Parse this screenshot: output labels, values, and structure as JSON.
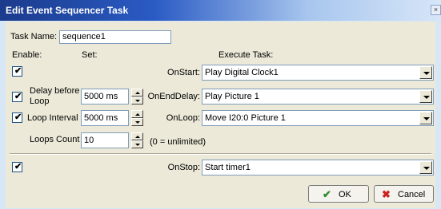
{
  "window": {
    "title": "Edit Event Sequencer Task",
    "close_glyph": "×"
  },
  "task_name": {
    "label": "Task Name:",
    "value": "sequence1"
  },
  "headers": {
    "enable": "Enable:",
    "set": "Set:",
    "execute": "Execute Task:"
  },
  "rows": {
    "onstart": {
      "enabled": true,
      "label": "OnStart:",
      "task": "Play Digital Clock1"
    },
    "delay": {
      "enabled": true,
      "set_label_line1": "Delay before",
      "set_label_line2": "Loop",
      "set_value": "5000 ms",
      "label": "OnEndDelay:",
      "task": "Play Picture 1"
    },
    "loop": {
      "enabled": true,
      "set_label": "Loop Interval",
      "set_value": "5000 ms",
      "label": "OnLoop:",
      "task": "Move I20:0 Picture 1"
    },
    "loops_count": {
      "label": "Loops Count",
      "value": "10",
      "note": "(0 = unlimited)"
    },
    "onstop": {
      "enabled": true,
      "label": "OnStop:",
      "task": "Start timer1"
    }
  },
  "buttons": {
    "ok": "OK",
    "cancel": "Cancel"
  },
  "icons": {
    "ok": "check-icon",
    "cancel": "x-icon",
    "checkmark": "✔",
    "cross": "✖",
    "check_color": "#2e8b2e",
    "cross_color": "#cc2222"
  }
}
